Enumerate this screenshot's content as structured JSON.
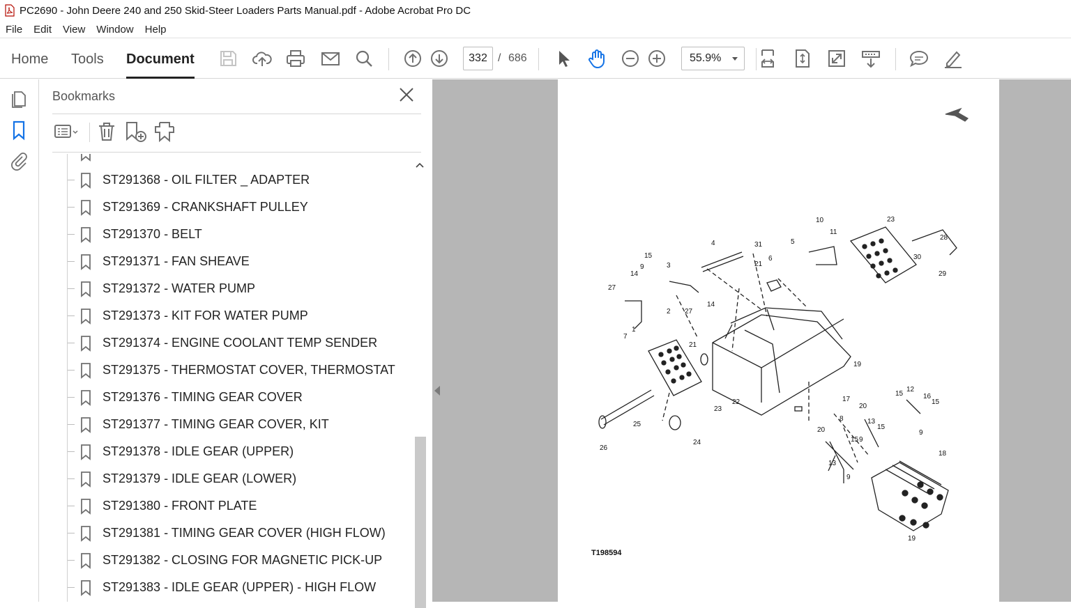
{
  "window": {
    "title": "PC2690 - John Deere 240 and 250 Skid-Steer Loaders Parts Manual.pdf - Adobe Acrobat Pro DC"
  },
  "menu": [
    "File",
    "Edit",
    "View",
    "Window",
    "Help"
  ],
  "nav_tabs": {
    "home": "Home",
    "tools": "Tools",
    "document": "Document"
  },
  "toolbar": {
    "icons": [
      "save-icon",
      "upload-icon",
      "print-icon",
      "email-icon",
      "search-icon",
      "prev-page-icon",
      "next-page-icon",
      "select-icon",
      "hand-icon",
      "zoom-out-icon",
      "zoom-in-icon",
      "fit-width-icon",
      "fit-page-icon",
      "full-screen-icon",
      "scroll-mode-icon",
      "comment-icon",
      "sign-icon"
    ],
    "page_current": "332",
    "page_separator": "/",
    "page_total": "686",
    "zoom": "55.9%"
  },
  "bookmarks": {
    "header": "Bookmarks",
    "items": [
      "ST291368 - OIL FILTER _ ADAPTER",
      "ST291369 - CRANKSHAFT PULLEY",
      "ST291370 - BELT",
      "ST291371 - FAN SHEAVE",
      "ST291372 - WATER PUMP",
      "ST291373 - KIT FOR WATER PUMP",
      "ST291374 - ENGINE COOLANT TEMP SENDER",
      "ST291375 - THERMOSTAT COVER, THERMOSTAT",
      "ST291376 - TIMING GEAR COVER",
      "ST291377 - TIMING GEAR COVER, KIT",
      "ST291378 - IDLE GEAR (UPPER)",
      "ST291379 - IDLE GEAR (LOWER)",
      "ST291380 - FRONT PLATE",
      "ST291381 - TIMING GEAR COVER (HIGH FLOW)",
      "ST291382 - CLOSING FOR MAGNETIC PICK-UP",
      "ST291383 - IDLE GEAR (UPPER) - HIGH FLOW"
    ]
  },
  "document_page": {
    "figure_code": "T198594",
    "callouts": [
      "1",
      "2",
      "3",
      "4",
      "5",
      "6",
      "7",
      "8",
      "9",
      "10",
      "11",
      "12",
      "13",
      "14",
      "15",
      "16",
      "17",
      "18",
      "19",
      "20",
      "21",
      "22",
      "23",
      "24",
      "25",
      "26",
      "27",
      "28",
      "29",
      "30",
      "31"
    ]
  },
  "colors": {
    "accent_blue": "#1473e6",
    "viewer_bg": "#b6b6b6",
    "icon_gray": "#707070"
  }
}
